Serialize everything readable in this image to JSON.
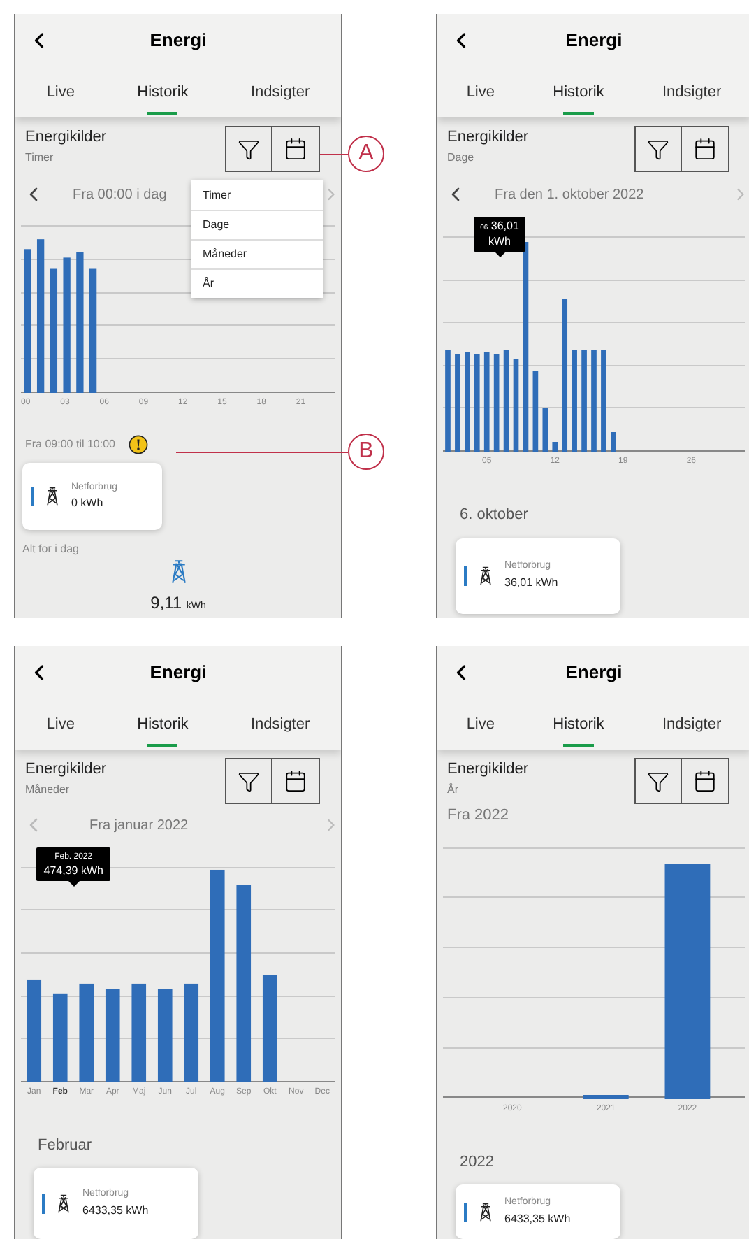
{
  "panels": [
    {
      "title": "Energi",
      "tabs": [
        {
          "label": "Live",
          "selected": false
        },
        {
          "label": "Historik",
          "selected": true
        },
        {
          "label": "Indsigter",
          "selected": false
        }
      ],
      "section_title": "Energikilder",
      "period": "Timer",
      "range_label": "Fra 00:00 i dag",
      "nav": {
        "prev_disabled": false,
        "next_disabled": true
      },
      "x_labels": [
        "00",
        "03",
        "06",
        "09",
        "12",
        "15",
        "18",
        "21"
      ],
      "menu": [
        {
          "label": "Timer"
        },
        {
          "label": "Dage"
        },
        {
          "label": "Måneder"
        },
        {
          "label": "År"
        }
      ],
      "detail_heading": {
        "text": "Fra 09:00 til 10:00",
        "warning": true
      },
      "card": {
        "label": "Netforbrug",
        "value": "0 kWh"
      },
      "total": {
        "label": "Alt for i dag",
        "value": "9,11",
        "unit": "kWh"
      }
    },
    {
      "title": "Energi",
      "tabs": [
        {
          "label": "Live",
          "selected": false
        },
        {
          "label": "Historik",
          "selected": true
        },
        {
          "label": "Indsigter",
          "selected": false
        }
      ],
      "section_title": "Energikilder",
      "period": "Dage",
      "range_label": "Fra den 1. oktober 2022",
      "nav": {
        "prev_disabled": false,
        "next_disabled": true
      },
      "x_labels": [
        "05",
        "12",
        "19",
        "26"
      ],
      "tooltip": {
        "kind": "inline",
        "caption": "06",
        "value": "36,01",
        "unit": "kWh"
      },
      "detail_heading": {
        "text": "6. oktober",
        "warning": false
      },
      "card": {
        "label": "Netforbrug",
        "value": "36,01 kWh"
      }
    },
    {
      "title": "Energi",
      "tabs": [
        {
          "label": "Live",
          "selected": false
        },
        {
          "label": "Historik",
          "selected": true
        },
        {
          "label": "Indsigter",
          "selected": false
        }
      ],
      "section_title": "Energikilder",
      "period": "Måneder",
      "range_label": "Fra januar 2022",
      "nav": {
        "prev_disabled": true,
        "next_disabled": true
      },
      "x_labels": [
        {
          "label": "Jan",
          "selected": false
        },
        {
          "label": "Feb",
          "selected": true
        },
        {
          "label": "Mar",
          "selected": false
        },
        {
          "label": "Apr",
          "selected": false
        },
        {
          "label": "Maj",
          "selected": false
        },
        {
          "label": "Jun",
          "selected": false
        },
        {
          "label": "Jul",
          "selected": false
        },
        {
          "label": "Aug",
          "selected": false
        },
        {
          "label": "Sep",
          "selected": false
        },
        {
          "label": "Okt",
          "selected": false
        },
        {
          "label": "Nov",
          "selected": false
        },
        {
          "label": "Dec",
          "selected": false
        }
      ],
      "tooltip": {
        "kind": "stacked",
        "caption": "Feb. 2022",
        "value": "474,39",
        "unit": "kWh"
      },
      "detail_heading": {
        "text": "Februar",
        "warning": false
      },
      "card": {
        "label": "Netforbrug",
        "value": "6433,35 kWh"
      }
    },
    {
      "title": "Energi",
      "tabs": [
        {
          "label": "Live",
          "selected": false
        },
        {
          "label": "Historik",
          "selected": true
        },
        {
          "label": "Indsigter",
          "selected": false
        }
      ],
      "section_title": "Energikilder",
      "period": "År",
      "range_label": "Fra 2022",
      "x_labels": [
        "2020",
        "2021",
        "2022"
      ],
      "detail_heading": {
        "text": "2022",
        "warning": false
      },
      "card": {
        "label": "Netforbrug",
        "value": "6433,35 kWh"
      }
    }
  ],
  "callouts": [
    {
      "label": "A"
    },
    {
      "label": "B"
    }
  ]
}
